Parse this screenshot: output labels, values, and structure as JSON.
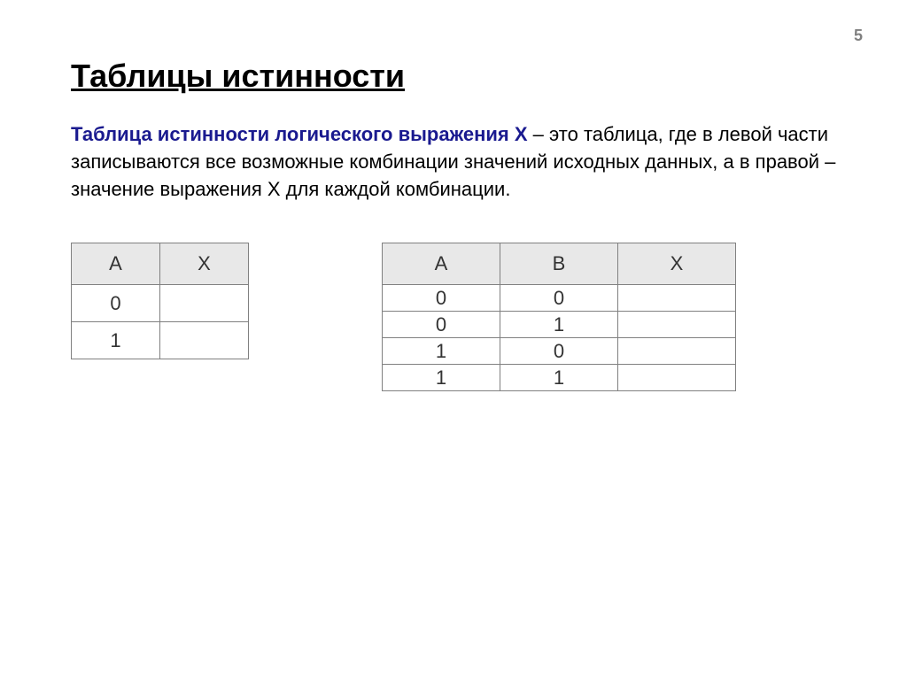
{
  "page_number": "5",
  "title": "Таблицы истинности",
  "description": {
    "highlight": "Таблица истинности логического выражения Х",
    "rest": " – это таблица, где в левой части записываются все возможные комбинации значений исходных данных, а в правой – значение выражения Х для каждой комбинации."
  },
  "table1": {
    "headers": [
      "A",
      "X"
    ],
    "rows": [
      [
        "0",
        ""
      ],
      [
        "1",
        ""
      ]
    ]
  },
  "table2": {
    "headers": [
      "A",
      "B",
      "X"
    ],
    "rows": [
      [
        "0",
        "0",
        ""
      ],
      [
        "0",
        "1",
        ""
      ],
      [
        "1",
        "0",
        ""
      ],
      [
        "1",
        "1",
        ""
      ]
    ]
  }
}
